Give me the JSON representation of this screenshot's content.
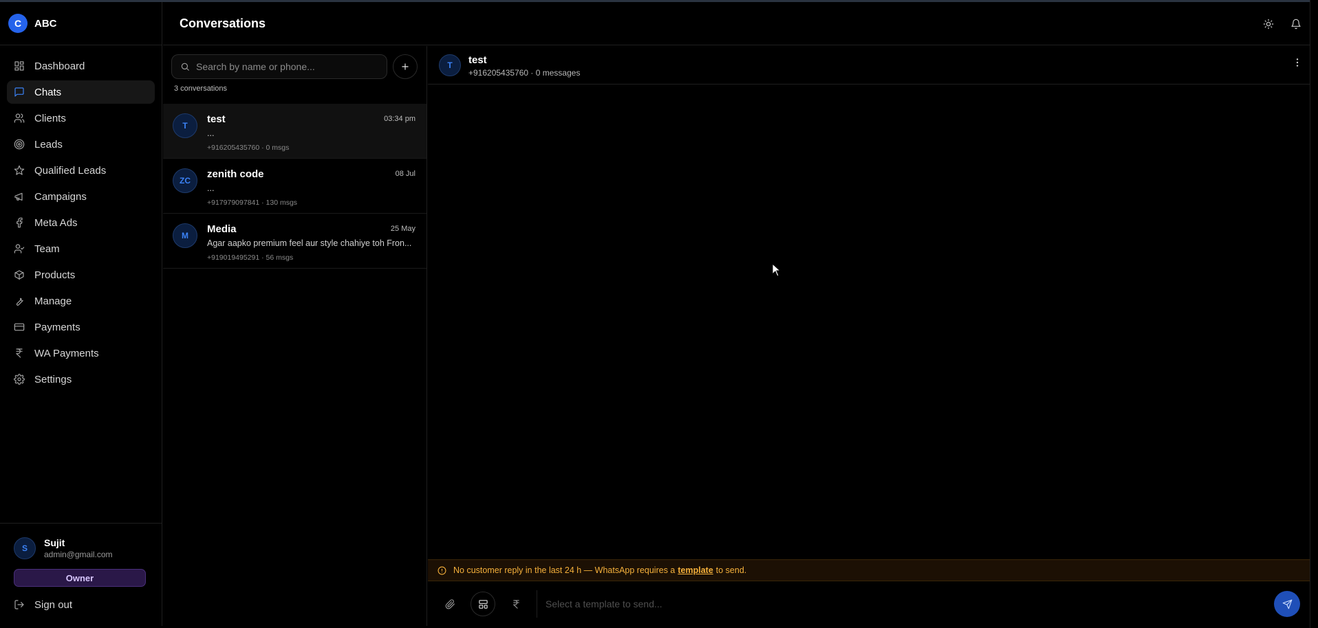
{
  "brand": {
    "initial": "C",
    "name": "ABC"
  },
  "header": {
    "title": "Conversations"
  },
  "nav": [
    {
      "label": "Dashboard",
      "icon": "dashboard-icon",
      "active": false
    },
    {
      "label": "Chats",
      "icon": "chat-icon",
      "active": true
    },
    {
      "label": "Clients",
      "icon": "users-icon",
      "active": false
    },
    {
      "label": "Leads",
      "icon": "target-icon",
      "active": false
    },
    {
      "label": "Qualified Leads",
      "icon": "star-icon",
      "active": false
    },
    {
      "label": "Campaigns",
      "icon": "megaphone-icon",
      "active": false
    },
    {
      "label": "Meta Ads",
      "icon": "facebook-icon",
      "active": false
    },
    {
      "label": "Team",
      "icon": "user-check-icon",
      "active": false
    },
    {
      "label": "Products",
      "icon": "box-icon",
      "active": false
    },
    {
      "label": "Manage",
      "icon": "wrench-icon",
      "active": false
    },
    {
      "label": "Payments",
      "icon": "credit-card-icon",
      "active": false
    },
    {
      "label": "WA Payments",
      "icon": "rupee-icon",
      "active": false
    },
    {
      "label": "Settings",
      "icon": "gear-icon",
      "active": false
    }
  ],
  "user": {
    "initial": "S",
    "name": "Sujit",
    "email": "admin@gmail.com",
    "role": "Owner",
    "signout_label": "Sign out"
  },
  "conversations": {
    "search_placeholder": "Search by name or phone...",
    "count_label": "3 conversations",
    "items": [
      {
        "initials": "T",
        "name": "test",
        "time": "03:34 pm",
        "preview": "...",
        "meta": "+916205435760 · 0 msgs",
        "selected": true
      },
      {
        "initials": "ZC",
        "name": "zenith code",
        "time": "08 Jul",
        "preview": "...",
        "meta": "+917979097841 · 130 msgs",
        "selected": false
      },
      {
        "initials": "M",
        "name": "Media",
        "time": "25 May",
        "preview": "Agar aapko premium feel aur style chahiye toh Fron...",
        "meta": "+919019495291 · 56 msgs",
        "selected": false
      }
    ]
  },
  "chat": {
    "initials": "T",
    "name": "test",
    "subtitle": "+916205435760 · 0 messages",
    "warning_before": "No customer reply in the last 24 h — WhatsApp requires a",
    "warning_link": "template",
    "warning_after": "to send.",
    "composer_placeholder": "Select a template to send..."
  },
  "colors": {
    "accent": "#2563eb",
    "warning": "#f5b03b",
    "role_badge": "#2a1848"
  }
}
